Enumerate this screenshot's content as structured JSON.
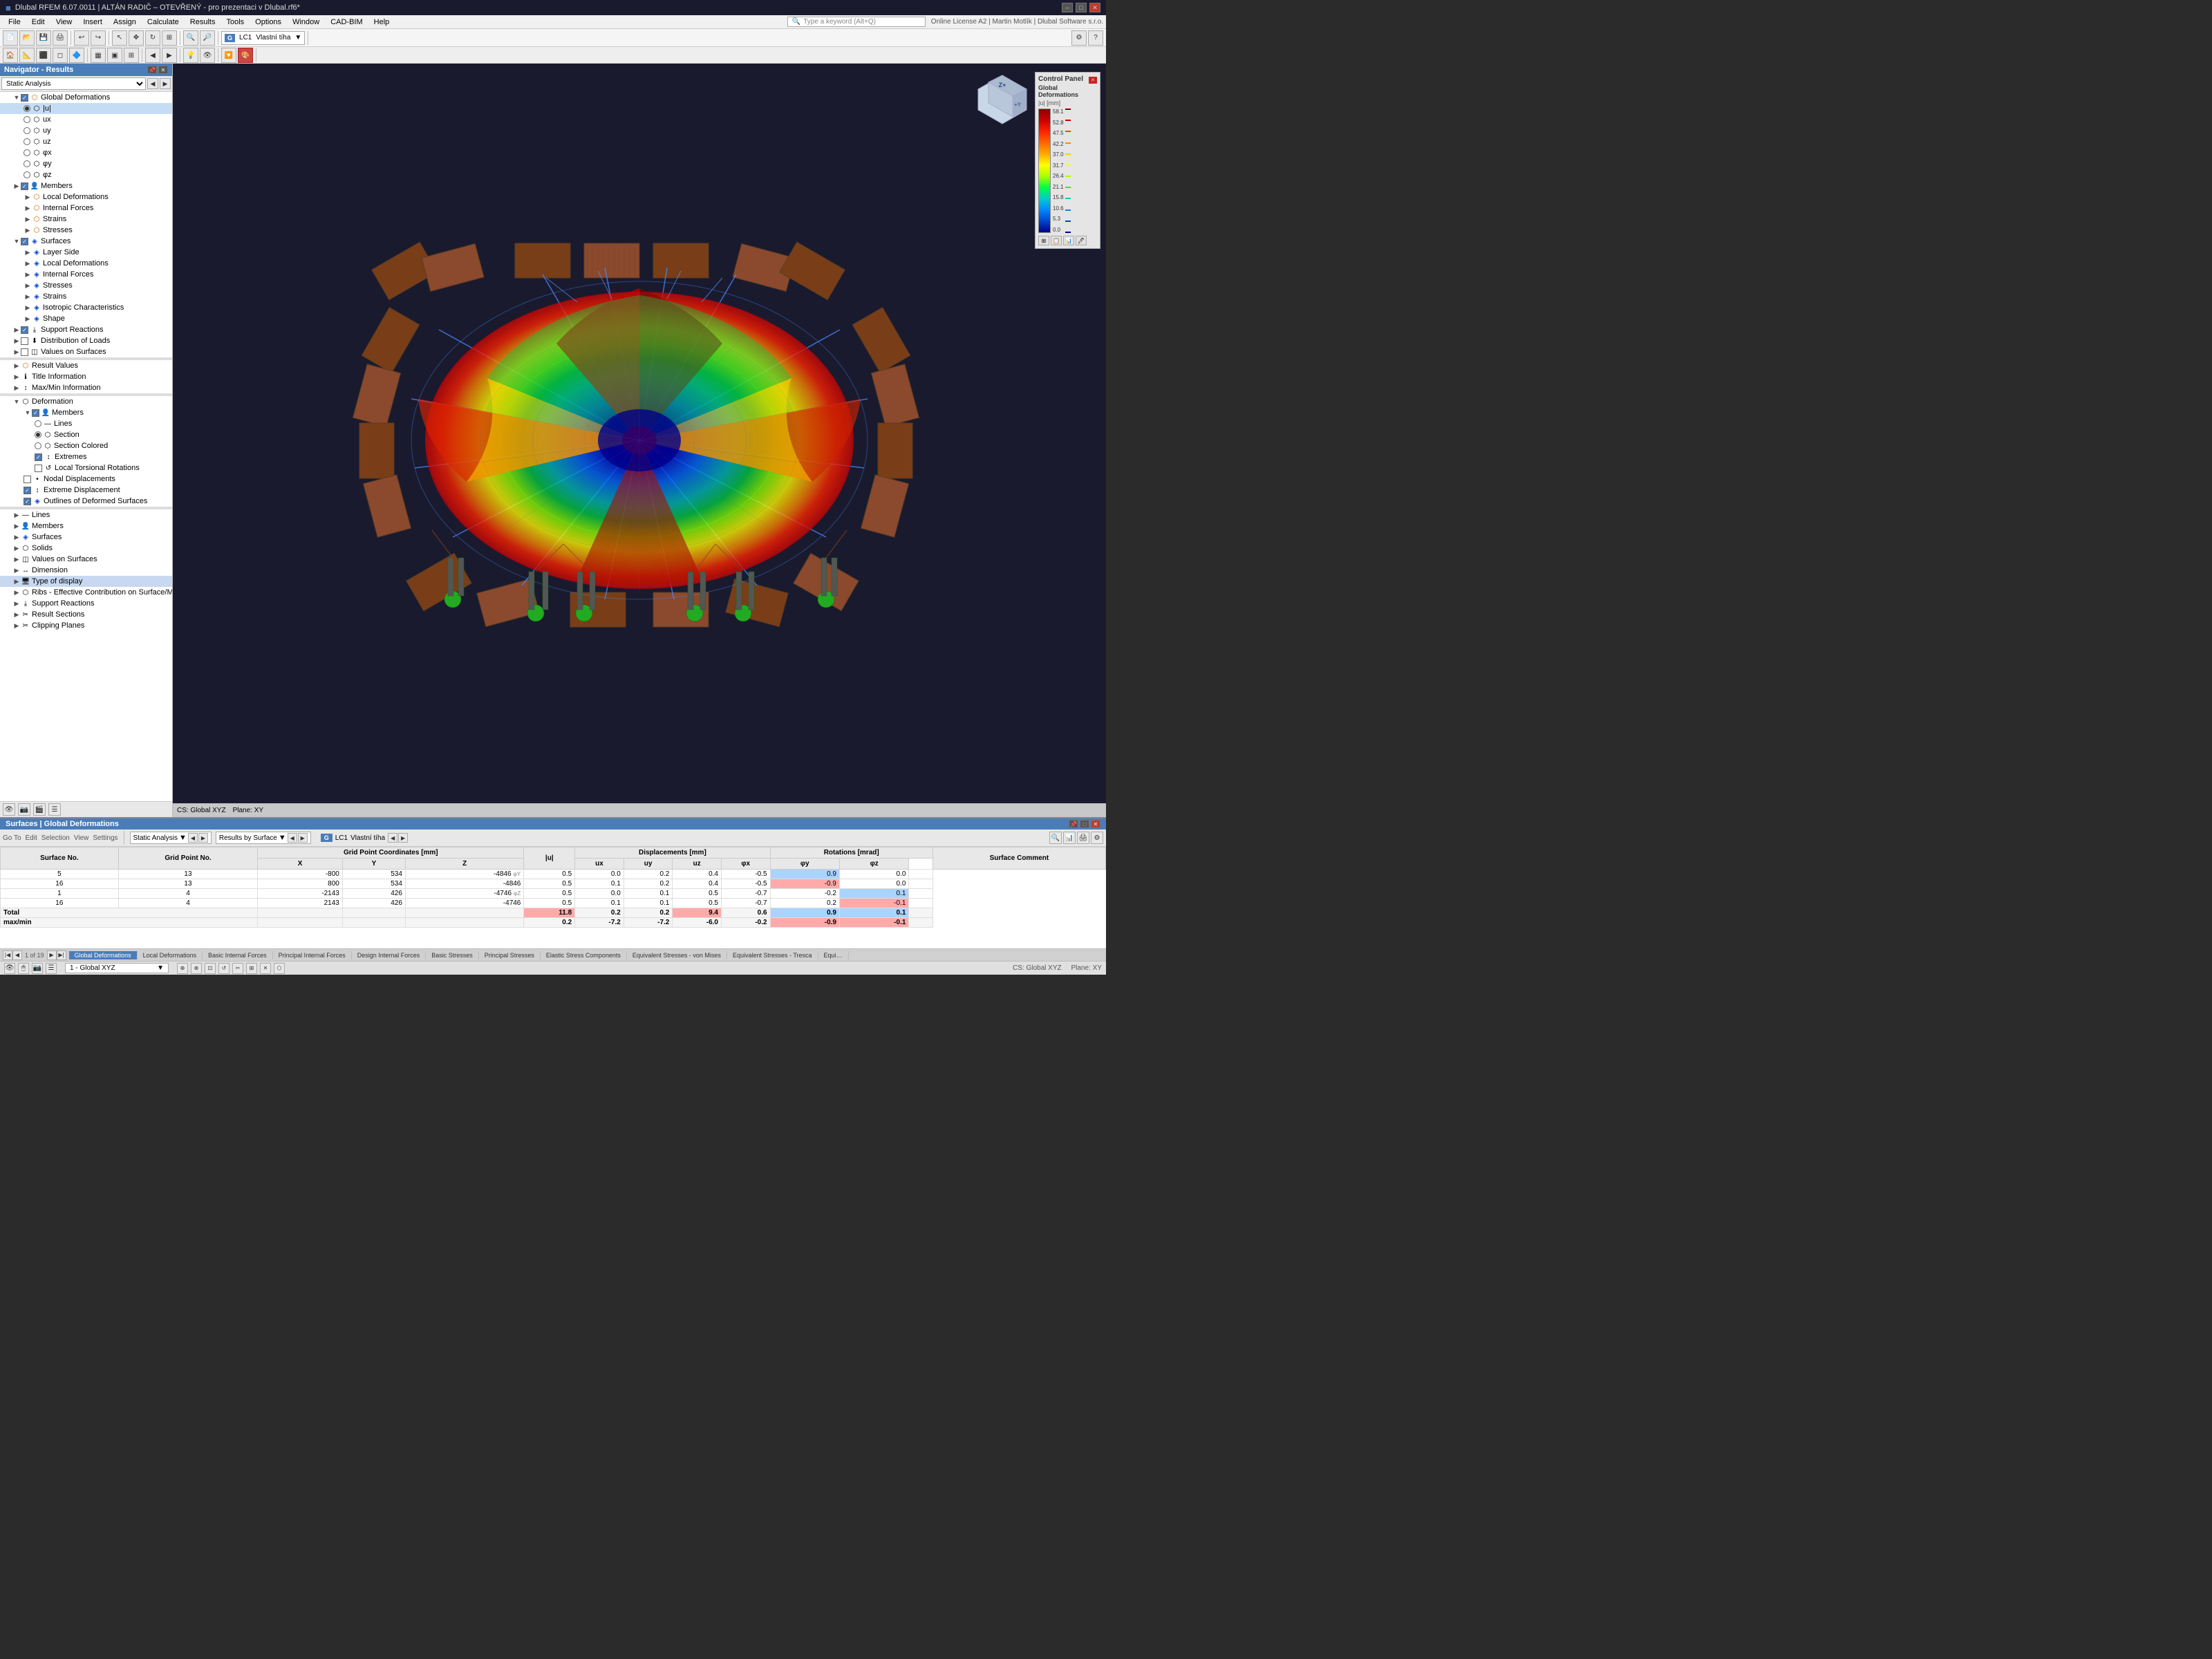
{
  "titleBar": {
    "text": "Dlubal RFEM 6.07.0011 | ALTÁN RADIČ – OTEVŘENÝ - pro prezentaci v Dlubal.rf6*",
    "buttons": [
      "–",
      "□",
      "✕"
    ]
  },
  "menuBar": {
    "items": [
      "File",
      "Edit",
      "View",
      "Insert",
      "Assign",
      "Calculate",
      "Results",
      "Tools",
      "Options",
      "Window",
      "CAD-BIM",
      "Help"
    ]
  },
  "navigator": {
    "title": "Navigator - Results",
    "dropdown": "Static Analysis",
    "sections": {
      "globalDeformations": {
        "label": "Global Deformations",
        "checked": true,
        "items": [
          "|u|",
          "ux",
          "uy",
          "uz",
          "φx",
          "φy",
          "φz"
        ],
        "selectedItem": "|u|"
      },
      "members": {
        "label": "Members",
        "items": [
          "Local Deformations",
          "Internal Forces",
          "Strains",
          "Stresses"
        ]
      },
      "surfaces": {
        "label": "Surfaces",
        "items": [
          "Layer Side",
          "Local Deformations",
          "Internal Forces",
          "Stresses",
          "Strains",
          "Isotropic Characteristics",
          "Shape"
        ]
      },
      "supportReactions": {
        "label": "Support Reactions",
        "checked": true
      },
      "distributionOfLoads": {
        "label": "Distribution of Loads",
        "checked": false
      },
      "valuesOnSurfaces": {
        "label": "Values on Surfaces",
        "checked": false
      },
      "misc": [
        "Result Values",
        "Title Information",
        "Max/Min Information"
      ],
      "deformation": {
        "label": "Deformation",
        "members": {
          "label": "Members",
          "items": [
            "Lines",
            "Section",
            "Section Colored",
            "Extremes",
            "Local Torsional Rotations"
          ]
        },
        "items": [
          "Nodal Displacements",
          "Extreme Displacement",
          "Outlines of Deformed Surfaces"
        ]
      },
      "bottom": [
        "Lines",
        "Members",
        "Surfaces",
        "Solids",
        "Values on Surfaces",
        "Dimension",
        "Type of display",
        "Ribs - Effective Contribution on Surface/Member",
        "Support Reactions",
        "Result Sections",
        "Clipping Planes"
      ]
    }
  },
  "controlPanel": {
    "title": "Control Panel",
    "subtitle": "Global Deformations",
    "unit": "|u| [mm]",
    "values": [
      "58.1",
      "52.8",
      "47.5",
      "42.2",
      "37.0",
      "31.7",
      "26.4",
      "21.1",
      "15.8",
      "10.6",
      "5.3",
      "0.0"
    ],
    "colors": [
      "#8b0000",
      "#cc0000",
      "#dd2200",
      "#ee4400",
      "#ff8800",
      "#ffcc00",
      "#ffff00",
      "#aaff00",
      "#00cc44",
      "#0088cc",
      "#0044dd",
      "#000088"
    ]
  },
  "loadCase": {
    "label": "G",
    "name": "LC1",
    "description": "Vlastní tíha"
  },
  "bottomPanel": {
    "title": "Surfaces | Global Deformations",
    "toolbar": {
      "analysis": "Static Analysis",
      "results": "Results by Surface",
      "loadCase": "G  LC1  Vlastní tíha"
    },
    "table": {
      "headers": [
        "Surface No.",
        "Grid Point No.",
        "X",
        "Y",
        "Z",
        "|u|",
        "ux",
        "uy",
        "uz",
        "φx",
        "φy",
        "φz",
        "Surface Comment"
      ],
      "headerGroups": {
        "gridPointCoords": "Grid Point Coordinates [mm]",
        "displacements": "Displacements [mm]",
        "rotations": "Rotations [mrad]"
      },
      "rows": [
        {
          "surface": "5",
          "grid": "13",
          "x": "-800",
          "y": "534",
          "z": "-4846",
          "note": "φY",
          "u": "0.5",
          "ux": "0.0",
          "uy": "0.2",
          "uz": "0.4",
          "px": "-0.5",
          "py": "0.9",
          "pz": "0.0"
        },
        {
          "surface": "16",
          "grid": "13",
          "x": "800",
          "y": "534",
          "z": "-4846",
          "note": "",
          "u": "0.5",
          "ux": "0.1",
          "uy": "0.2",
          "uz": "0.4",
          "px": "-0.5",
          "py": "-0.9",
          "pz": "0.0"
        },
        {
          "surface": "1",
          "grid": "4",
          "x": "-2143",
          "y": "426",
          "z": "-4746",
          "note": "φZ",
          "u": "0.5",
          "ux": "0.0",
          "uy": "0.1",
          "uz": "0.5",
          "px": "-0.7",
          "py": "-0.2",
          "pz": "0.1"
        },
        {
          "surface": "16",
          "grid": "4",
          "x": "2143",
          "y": "426",
          "z": "-4746",
          "note": "",
          "u": "0.5",
          "ux": "0.1",
          "uy": "0.1",
          "uz": "0.5",
          "px": "-0.7",
          "py": "0.2",
          "pz": "-0.1"
        }
      ],
      "totals": {
        "label": "Total max/min",
        "maxValues": {
          "u": "11.8",
          "ux": "0.2",
          "uy": "0.2",
          "uz": "9.4",
          "px": "0.6",
          "py": "0.9",
          "pz": "0.1"
        },
        "minValues": {
          "u": "0.2",
          "ux": "-7.2",
          "uy": "-7.2",
          "uz": "-6.0",
          "px": "-0.2",
          "py": "-0.9",
          "pz": "-0.1"
        }
      }
    },
    "pager": "1 of 19"
  },
  "bottomTabs": [
    "Global Deformations",
    "Local Deformations",
    "Basic Internal Forces",
    "Principal Internal Forces",
    "Design Internal Forces",
    "Basic Stresses",
    "Principal Stresses",
    "Elastic Stress Components",
    "Equivalent Stresses - von Mises",
    "Equivalent Stresses - Tresca",
    "Equi"
  ],
  "statusBar": {
    "left": "1 - Global XYZ",
    "right": "CS: Global XYZ    Plane: XY"
  },
  "viewport": {
    "bottomBar": "CS: Global XYZ    Plane: XY"
  }
}
